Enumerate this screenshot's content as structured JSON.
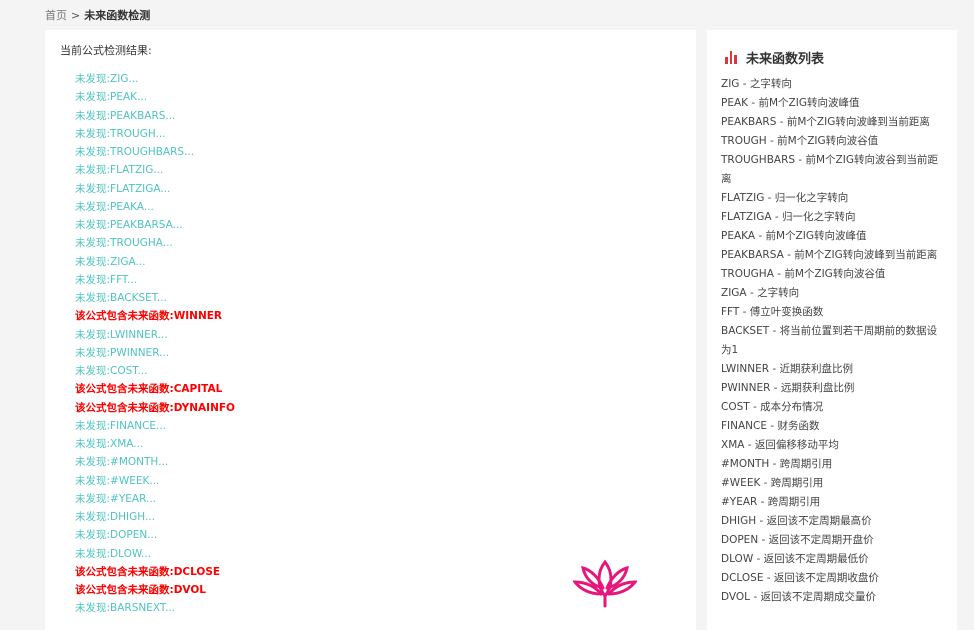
{
  "breadcrumb": {
    "home": "首页",
    "separator": ">",
    "current": "未来函数检测"
  },
  "results": {
    "heading": "当前公式检测结果:",
    "items": [
      {
        "text": "未发现:ZIG...",
        "status": "ok"
      },
      {
        "text": "未发现:PEAK...",
        "status": "ok"
      },
      {
        "text": "未发现:PEAKBARS...",
        "status": "ok"
      },
      {
        "text": "未发现:TROUGH...",
        "status": "ok"
      },
      {
        "text": "未发现:TROUGHBARS...",
        "status": "ok"
      },
      {
        "text": "未发现:FLATZIG...",
        "status": "ok"
      },
      {
        "text": "未发现:FLATZIGA...",
        "status": "ok"
      },
      {
        "text": "未发现:PEAKA...",
        "status": "ok"
      },
      {
        "text": "未发现:PEAKBARSA...",
        "status": "ok"
      },
      {
        "text": "未发现:TROUGHA...",
        "status": "ok"
      },
      {
        "text": "未发现:ZIGA...",
        "status": "ok"
      },
      {
        "text": "未发现:FFT...",
        "status": "ok"
      },
      {
        "text": "未发现:BACKSET...",
        "status": "ok"
      },
      {
        "text": "该公式包含未来函数:WINNER",
        "status": "found"
      },
      {
        "text": "未发现:LWINNER...",
        "status": "ok"
      },
      {
        "text": "未发现:PWINNER...",
        "status": "ok"
      },
      {
        "text": "未发现:COST...",
        "status": "ok"
      },
      {
        "text": "该公式包含未来函数:CAPITAL",
        "status": "found"
      },
      {
        "text": "该公式包含未来函数:DYNAINFO",
        "status": "found"
      },
      {
        "text": "未发现:FINANCE...",
        "status": "ok"
      },
      {
        "text": "未发现:XMA...",
        "status": "ok"
      },
      {
        "text": "未发现:#MONTH...",
        "status": "ok"
      },
      {
        "text": "未发现:#WEEK...",
        "status": "ok"
      },
      {
        "text": "未发现:#YEAR...",
        "status": "ok"
      },
      {
        "text": "未发现:DHIGH...",
        "status": "ok"
      },
      {
        "text": "未发现:DOPEN...",
        "status": "ok"
      },
      {
        "text": "未发现:DLOW...",
        "status": "ok"
      },
      {
        "text": "该公式包含未来函数:DCLOSE",
        "status": "found"
      },
      {
        "text": "该公式包含未来函数:DVOL",
        "status": "found"
      },
      {
        "text": "未发现:BARSNEXT...",
        "status": "ok"
      }
    ]
  },
  "sidebar": {
    "title": "未来函数列表",
    "items": [
      "ZIG - 之字转向",
      "PEAK - 前M个ZIG转向波峰值",
      "PEAKBARS - 前M个ZIG转向波峰到当前距离",
      "TROUGH - 前M个ZIG转向波谷值",
      "TROUGHBARS - 前M个ZIG转向波谷到当前距离",
      "FLATZIG - 归一化之字转向",
      "FLATZIGA - 归一化之字转向",
      "PEAKA - 前M个ZIG转向波峰值",
      "PEAKBARSA - 前M个ZIG转向波峰到当前距离",
      "TROUGHA - 前M个ZIG转向波谷值",
      "ZIGA - 之字转向",
      "FFT - 傅立叶变换函数",
      "BACKSET - 将当前位置到若干周期前的数据设为1",
      "LWINNER - 近期获利盘比例",
      "PWINNER - 远期获利盘比例",
      "COST - 成本分布情况",
      "FINANCE - 财务函数",
      "XMA - 返回偏移移动平均",
      "#MONTH - 跨周期引用",
      "#WEEK - 跨周期引用",
      "#YEAR - 跨周期引用",
      "DHIGH - 返回该不定周期最高价",
      "DOPEN - 返回该不定周期开盘价",
      "DLOW - 返回该不定周期最低价",
      "DCLOSE - 返回该不定周期收盘价",
      "DVOL - 返回该不定周期成交量价"
    ]
  },
  "colors": {
    "ok": "#4fc3c0",
    "found": "#ff0000",
    "accent": "#d9383a",
    "logo": "#e6177a"
  }
}
